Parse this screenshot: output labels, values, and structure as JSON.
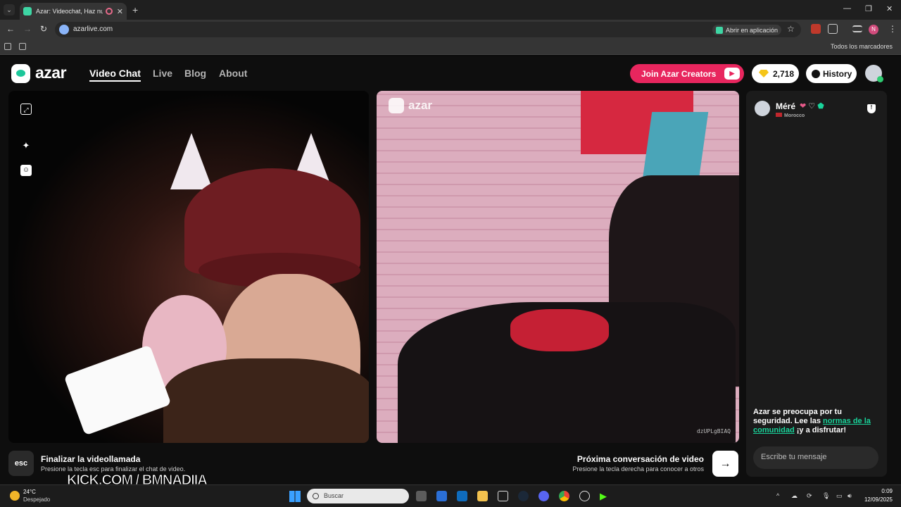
{
  "browser": {
    "tab_title": "Azar: Videochat, Haz nuevos",
    "url": "azarlive.com",
    "open_app": "Abrir en aplicación",
    "all_bookmarks": "Todos los marcadores",
    "profile_initial": "N"
  },
  "header": {
    "logo": "azar",
    "nav": [
      "Video Chat",
      "Live",
      "Blog",
      "About"
    ],
    "creators_button": "Join Azar Creators",
    "gems": "2,718",
    "history": "History"
  },
  "video": {
    "watermark": "azar",
    "stream_id": "dzUPLgBIAQ"
  },
  "chat": {
    "peer_name": "Méré",
    "peer_country": "Morocco",
    "safety_pre": "Azar se preocupa por tu seguridad. Lee las ",
    "safety_link": "normas de la comunidad",
    "safety_post": " ¡y a disfrutar!",
    "message_placeholder": "Escribe tu mensaje"
  },
  "controls": {
    "esc_key": "esc",
    "end_title": "Finalizar la videollamada",
    "end_sub": "Presione la tecla esc para finalizar el chat de video.",
    "next_title": "Próxima conversación de video",
    "next_sub": "Presione la tecla derecha para conocer a otros"
  },
  "overlay": {
    "kick": "KICK.COM / BMNADIIA"
  },
  "taskbar": {
    "temp": "24°C",
    "condition": "Despejado",
    "search": "Buscar",
    "time": "0:09",
    "date": "12/09/2025"
  },
  "colors": {
    "accent_pink": "#e8265e",
    "accent_green": "#19d49b"
  }
}
